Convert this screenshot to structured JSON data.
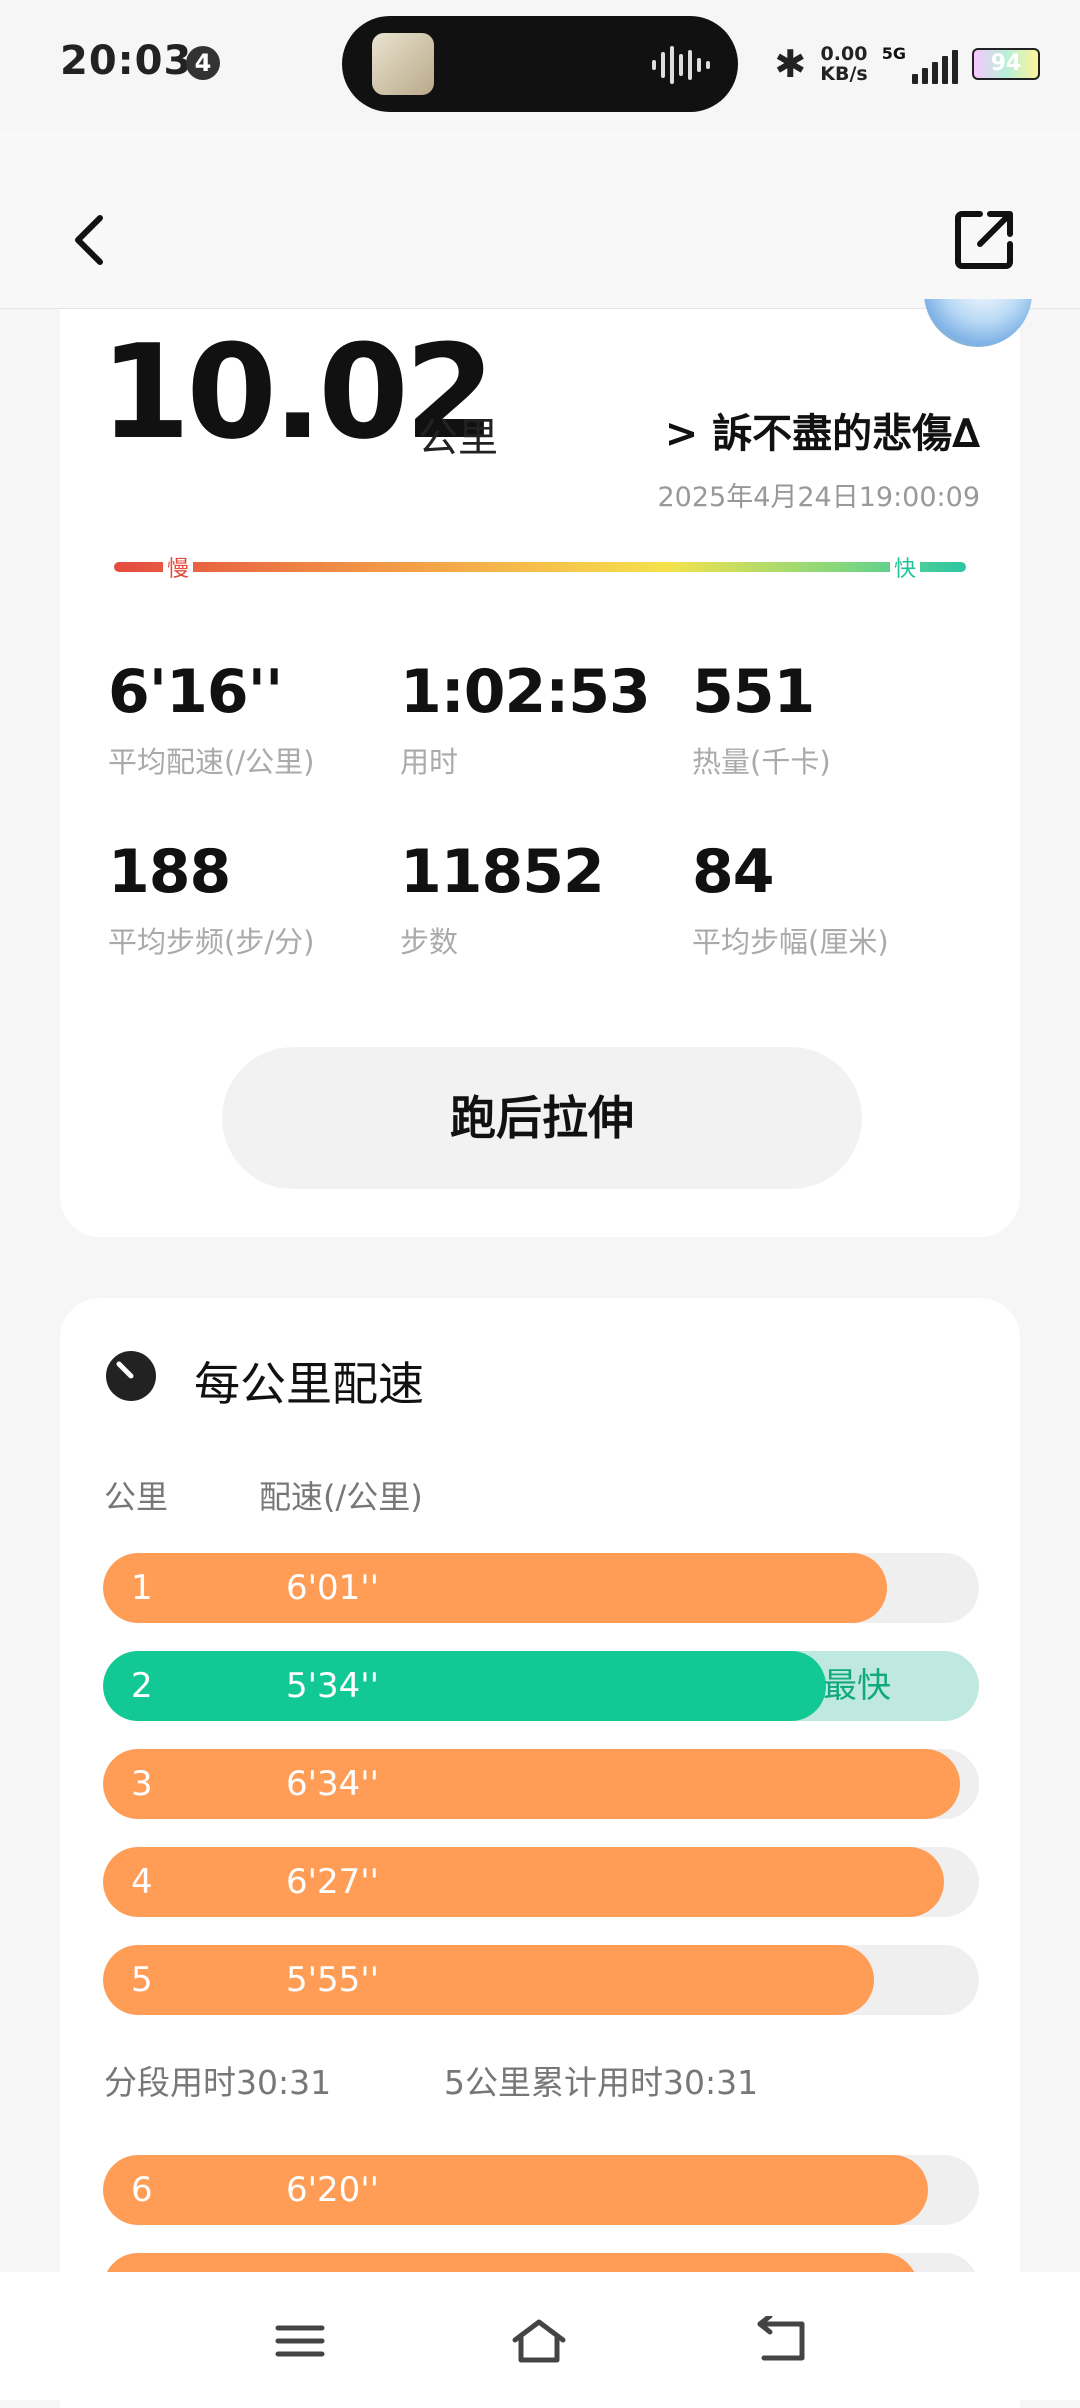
{
  "status": {
    "time": "20:03",
    "notif_count": "4",
    "net_speed_value": "0.00",
    "net_speed_unit": "KB/s",
    "network": "5G",
    "battery": "94"
  },
  "header": {
    "back_icon": "chevron-left-icon",
    "share_icon": "share-external-icon"
  },
  "summary": {
    "distance": "10.02",
    "distance_unit": "公里",
    "username": "> 訴不盡的悲傷∆",
    "datetime": "2025年4月24日19:00:09",
    "pace_slow_label": "慢",
    "pace_fast_label": "快",
    "stats": [
      {
        "value": "6'16''",
        "label": "平均配速(/公里)"
      },
      {
        "value": "1:02:53",
        "label": "用时"
      },
      {
        "value": "551",
        "label": "热量(千卡)"
      },
      {
        "value": "188",
        "label": "平均步频(步/分)"
      },
      {
        "value": "11852",
        "label": "步数"
      },
      {
        "value": "84",
        "label": "平均步幅(厘米)"
      }
    ],
    "stretch_button": "跑后拉伸"
  },
  "splits": {
    "title": "每公里配速",
    "col_km": "公里",
    "col_pace": "配速(/公里)",
    "fastest_tag": "最快",
    "rows": [
      {
        "km": "1",
        "pace": "6'01''",
        "fill_pct": 89.5,
        "fastest": false
      },
      {
        "km": "2",
        "pace": "5'34''",
        "fill_pct": 82.5,
        "fastest": true
      },
      {
        "km": "3",
        "pace": "6'34''",
        "fill_pct": 97.8,
        "fastest": false
      },
      {
        "km": "4",
        "pace": "6'27''",
        "fill_pct": 96.0,
        "fastest": false
      },
      {
        "km": "5",
        "pace": "5'55''",
        "fill_pct": 88.0,
        "fastest": false
      },
      {
        "km": "6",
        "pace": "6'20''",
        "fill_pct": 94.2,
        "fastest": false
      }
    ],
    "segment_time": "分段用时30:31",
    "cumulative_time": "5公里累计用时30:31",
    "colors": {
      "normal": "#ff9d57",
      "fastest": "#12c995",
      "track": "#efefef"
    }
  },
  "navbar": {
    "menu_icon": "menu-icon",
    "home_icon": "home-icon",
    "back_icon": "back-icon"
  }
}
